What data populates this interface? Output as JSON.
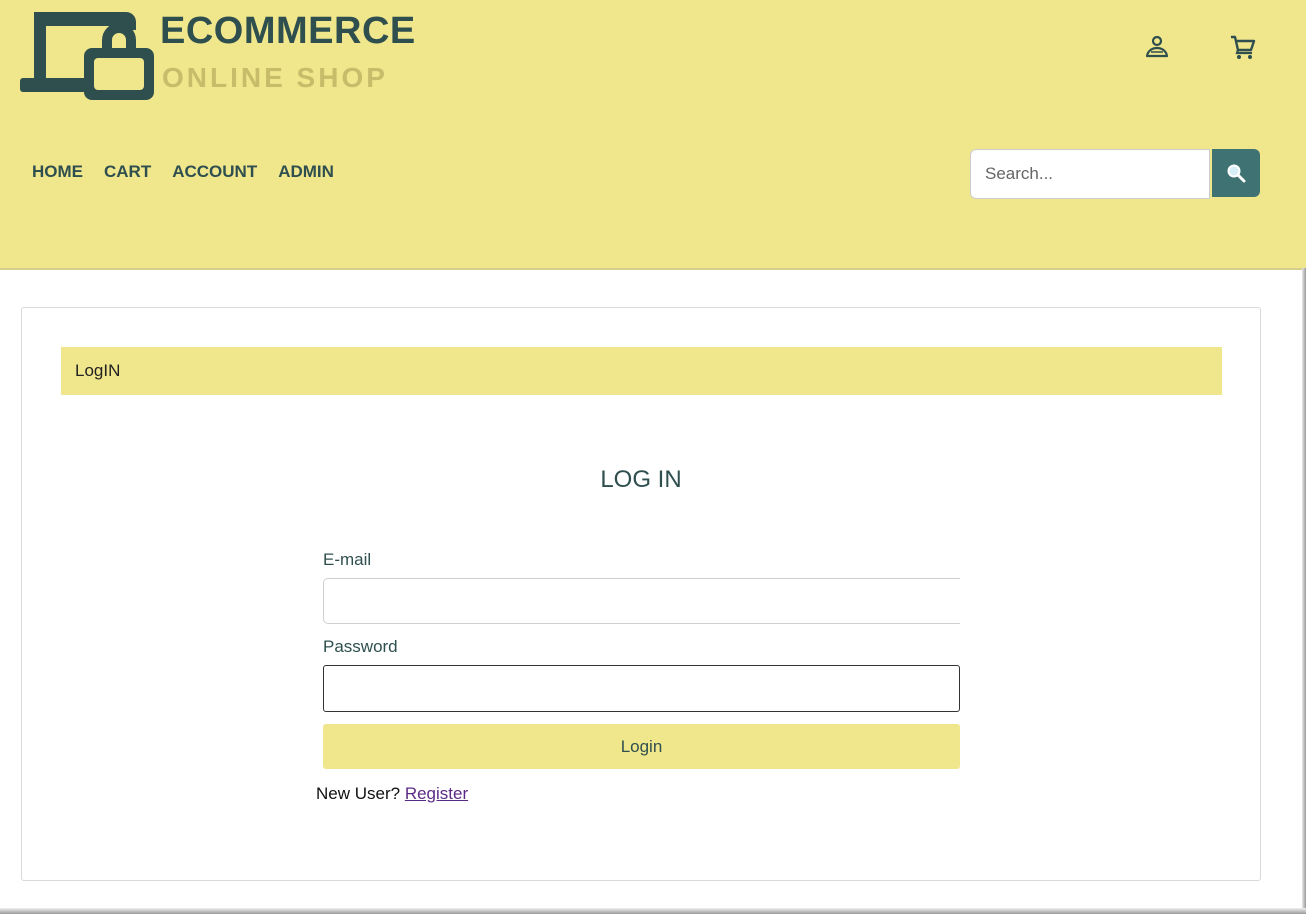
{
  "brand": {
    "title": "ECOMMERCE",
    "subtitle": "ONLINE SHOP",
    "logo_icon": "laptop-lock-icon",
    "primary_color": "#2f4f4f",
    "accent_color": "#f0e68c"
  },
  "header": {
    "account_icon": "user-icon",
    "cart_icon": "cart-icon"
  },
  "nav": {
    "items": [
      {
        "label": "HOME"
      },
      {
        "label": "CART"
      },
      {
        "label": "ACCOUNT"
      },
      {
        "label": "ADMIN"
      }
    ]
  },
  "search": {
    "placeholder": "Search...",
    "value": "",
    "button_icon": "search-icon"
  },
  "breadcrumb": {
    "label": "LogIN"
  },
  "login_form": {
    "title": "LOG IN",
    "email_label": "E-mail",
    "email_value": "",
    "password_label": "Password",
    "password_value": "",
    "submit_label": "Login",
    "new_user_text": "New User?",
    "register_link": "Register"
  }
}
